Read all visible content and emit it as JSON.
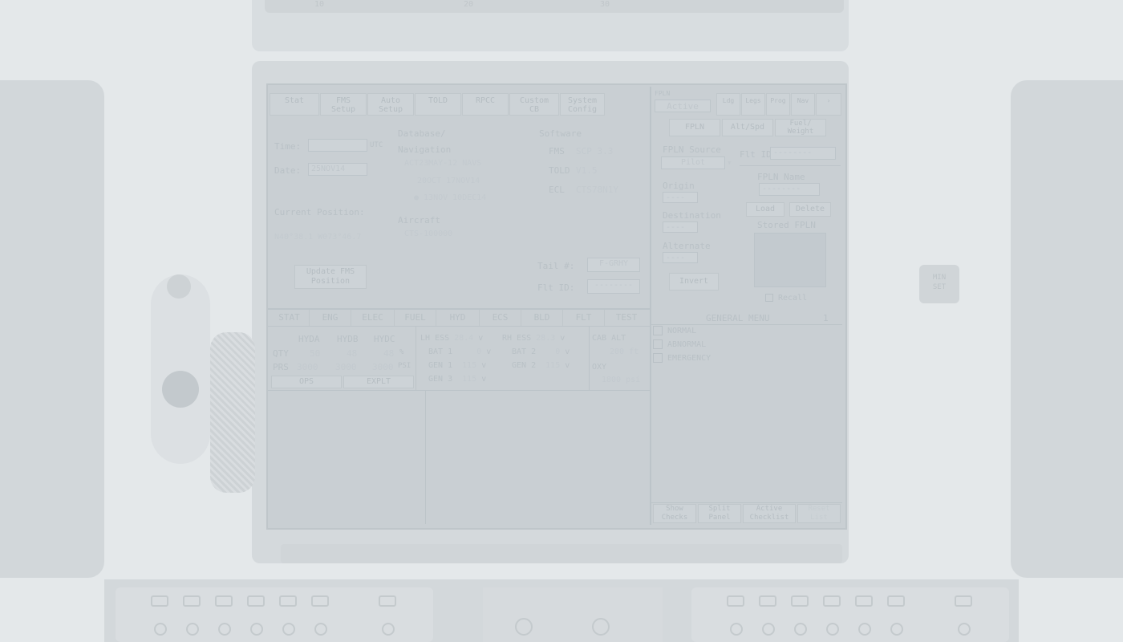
{
  "top_bezel": {
    "ticks": [
      "10",
      "20",
      "30"
    ]
  },
  "right_knob": {
    "label": "MIN\nSET"
  },
  "status": {
    "time_label": "Time:",
    "time_value": "",
    "time_unit": "UTC",
    "date_label": "Date:",
    "date_value": "25NOV14",
    "current_position_label": "Current Position:",
    "current_position_value": "N40°38.1 W073°46.7",
    "update_fms_button": "Update FMS\nPosition",
    "database_label": "Database/",
    "navigation_label": "Navigation",
    "nav_db_1": "ACT23MAY-12  NAVS",
    "nav_db_2": "20OCT 17NOV14",
    "nav_db_3": "● 13NOV 10DEC14",
    "aircraft_label": "Aircraft",
    "aircraft_value": "CTS-100000",
    "software_label": "Software",
    "fms_label": "FMS",
    "fms_value": "SCP 3.3",
    "told_label": "TOLD",
    "told_value": "V1.5",
    "ecl_label": "ECL",
    "ecl_value": "CTS78N1Y",
    "tail_label": "Tail #:",
    "tail_value": "F-GRHY",
    "flt_id_label": "Flt ID:",
    "flt_id_value": "--------"
  },
  "top_tabs": [
    {
      "label": "Stat"
    },
    {
      "label": "FMS\nSetup"
    },
    {
      "label": "Auto\nSetup"
    },
    {
      "label": "TOLD"
    },
    {
      "label": "RPCC"
    },
    {
      "label": "Custom\nCB"
    },
    {
      "label": "System\nConfig"
    }
  ],
  "fpln": {
    "active_label": "FPLN",
    "active_value": "Active",
    "sub_tabs": [
      "Ldg",
      "Legs",
      "Prog",
      "Nav"
    ],
    "tabs": [
      "FPLN",
      "Alt/Spd",
      "Fuel/\nWeight"
    ],
    "source_label": "FPLN Source",
    "source_value": "Pilot",
    "flt_id_label": "Flt ID:",
    "flt_id_value": "--------",
    "origin_label": "Origin",
    "origin_value": "----",
    "destination_label": "Destination",
    "destination_value": "----",
    "alternate_label": "Alternate",
    "alternate_value": "----",
    "fpln_name_label": "FPLN Name",
    "fpln_name_value": "--------",
    "stored_fpln_label": "Stored FPLN",
    "btn_load": "Load",
    "btn_delete": "Delete",
    "btn_invert": "Invert",
    "recall_label": "Recall"
  },
  "sys_tabs": [
    "STAT",
    "ENG",
    "ELEC",
    "FUEL",
    "HYD",
    "ECS",
    "BLD",
    "FLT",
    "TEST"
  ],
  "hydraulics": {
    "headers": [
      "HYDA",
      "HYDB",
      "HYDC"
    ],
    "qty_label": "QTY",
    "qty_values": [
      "50",
      "48",
      "48"
    ],
    "qty_unit": "%",
    "prs_label": "PRS",
    "prs_values": [
      "3000",
      "3000",
      "3000"
    ],
    "prs_unit": "PSI",
    "sub_tabs": [
      "OPS",
      "EXPLT"
    ]
  },
  "electrical": {
    "rows": [
      {
        "l1": "LH ESS",
        "v1": "28.4",
        "u1": "v",
        "l2": "RH ESS",
        "v2": "28.3",
        "u2": "v"
      },
      {
        "l1": "BAT 1",
        "v1": "0",
        "u1": "v",
        "l2": "BAT 2",
        "v2": "0",
        "u2": "v"
      },
      {
        "l1": "GEN 1",
        "v1": "115",
        "u1": "v",
        "l2": "GEN 2",
        "v2": "115",
        "u2": "v"
      },
      {
        "l1": "GEN 3",
        "v1": "115",
        "u1": "v",
        "l2": "",
        "v2": "",
        "u2": ""
      }
    ]
  },
  "cabin": {
    "alt_label": "CAB ALT",
    "alt_value": "200 ft",
    "oxy_label": "OXY",
    "oxy_value": "1800 psi"
  },
  "checklist": {
    "title": "GENERAL MENU",
    "page": "1",
    "items": [
      "NORMAL",
      "ABNORMAL",
      "EMERGENCY"
    ],
    "bottom_buttons": [
      "Show\nChecks",
      "Split\nPanel",
      "Active\nChecklist",
      "Reset\nList"
    ]
  }
}
